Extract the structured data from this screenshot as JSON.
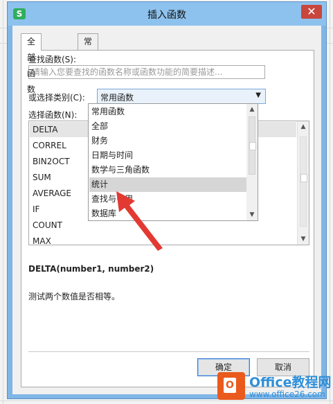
{
  "dialog": {
    "title": "插入函数",
    "close_glyph": "✕",
    "app_icon_letter": "S"
  },
  "tabs": [
    {
      "label": "全部函数",
      "active": true
    },
    {
      "label": "常用公式",
      "active": false
    }
  ],
  "search": {
    "label": "查找函数(S):",
    "placeholder": "请输入您要查找的函数名称或函数功能的简要描述..."
  },
  "category": {
    "label": "或选择类别(C):",
    "value": "常用函数"
  },
  "function_list": {
    "label": "选择函数(N):",
    "items": [
      "DELTA",
      "CORREL",
      "BIN2OCT",
      "SUM",
      "AVERAGE",
      "IF",
      "COUNT",
      "MAX"
    ],
    "selected": "DELTA"
  },
  "dropdown": {
    "items": [
      "常用函数",
      "全部",
      "财务",
      "日期与时间",
      "数学与三角函数",
      "统计",
      "查找与引用",
      "数据库"
    ],
    "highlighted": "统计"
  },
  "signature": "DELTA(number1, number2)",
  "description": "测试两个数值是否相等。",
  "buttons": {
    "ok": "确定",
    "cancel": "取消"
  },
  "watermark": {
    "brand": "Office教程网",
    "url": "www.office26.com"
  },
  "colors": {
    "accent_arrow": "#e23a33",
    "titlebar": "#8ec2ee"
  }
}
